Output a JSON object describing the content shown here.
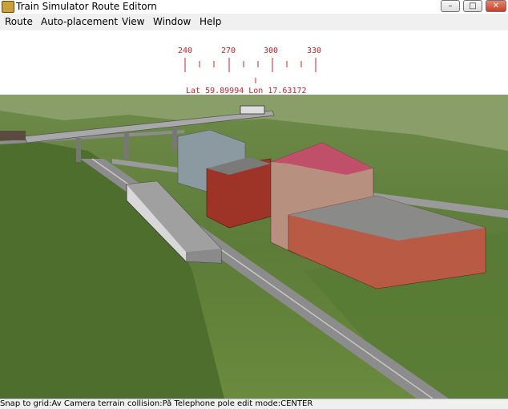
{
  "window": {
    "title": "Train Simulator Route Editorn",
    "minimize_symbol": "–",
    "maximize_symbol": "□",
    "close_symbol": "✕"
  },
  "menu": {
    "items": [
      "Route",
      "Auto-placement",
      "View",
      "Window",
      "Help"
    ]
  },
  "compass": {
    "ticks": [
      "240",
      "270",
      "300",
      "330"
    ],
    "coordinates": "Lat 59.89994 Lon 17.63172",
    "color": "#c8202a"
  },
  "scene": {
    "description_icons": [
      "terrain",
      "railway-track",
      "bridge",
      "buildings",
      "train"
    ]
  },
  "status": {
    "text": "Snap to grid:Av Camera terrain collision:På Telephone pole edit mode:CENTER"
  }
}
